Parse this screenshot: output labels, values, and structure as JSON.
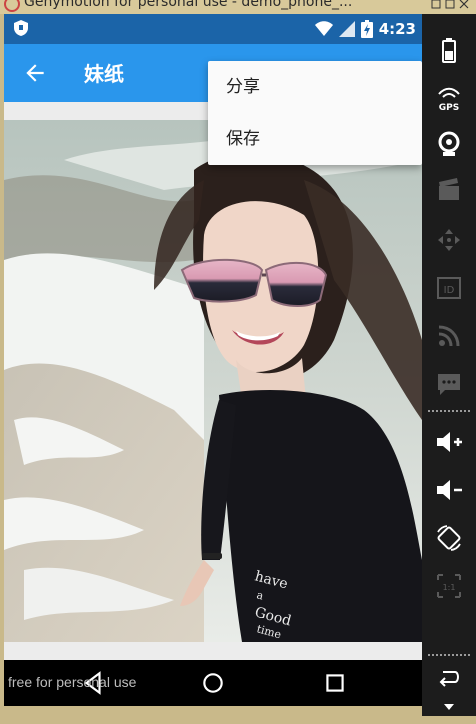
{
  "window": {
    "title": "Genymotion for personal use - demo_phone_..."
  },
  "status_bar": {
    "time": "4:23",
    "icons": [
      "shield-icon",
      "wifi-icon",
      "signal-icon",
      "battery-icon"
    ]
  },
  "app_bar": {
    "back_icon": "arrow-left-icon",
    "title": "妹纸"
  },
  "menu": {
    "items": [
      {
        "label": "分享"
      },
      {
        "label": "保存"
      }
    ]
  },
  "content": {
    "image_description_icon": "photo"
  },
  "nav_bar": {
    "icons": [
      "back-triangle-icon",
      "home-circle-icon",
      "recents-square-icon"
    ]
  },
  "watermark": "free for personal use",
  "sidebar": {
    "items": [
      "battery-icon",
      "gps-icon",
      "webcam-icon",
      "clapper-icon",
      "dpad-icon",
      "id-icon",
      "rss-icon",
      "sms-icon",
      "volume-up-icon",
      "volume-down-icon",
      "rotate-icon",
      "scale-icon",
      "back-arrow-icon",
      "menu-down-icon"
    ],
    "gps_label": "GPS",
    "id_label": "ID",
    "scale_label": "1:1"
  },
  "colors": {
    "status_bar": "#1b64a8",
    "app_bar": "#2a96ec",
    "menu_bg": "#fafafa",
    "sidebar_bg": "#1c1c1c"
  }
}
